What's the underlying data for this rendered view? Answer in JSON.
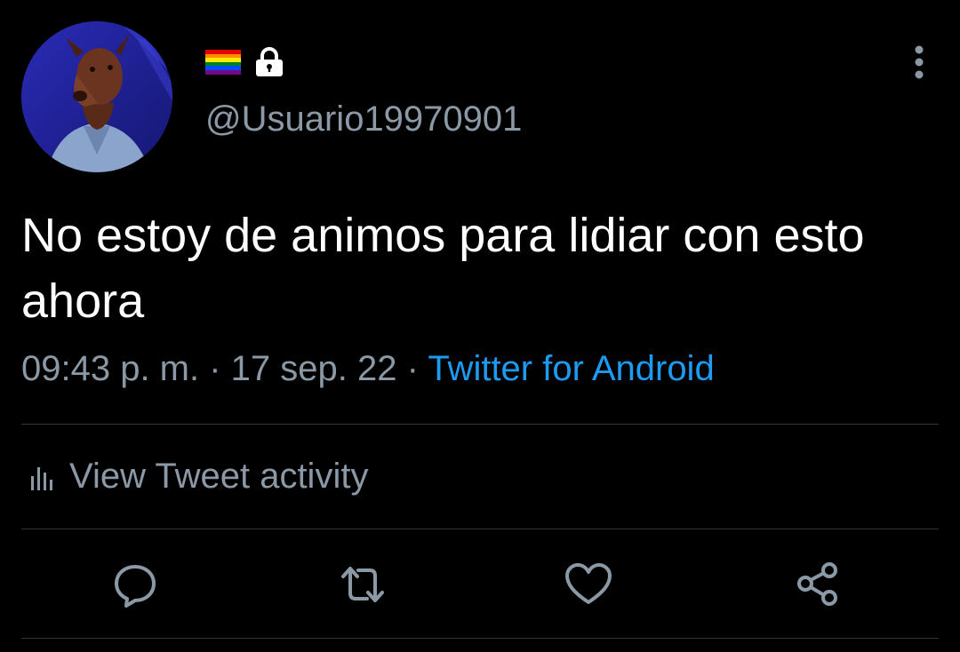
{
  "tweet": {
    "handle": "@Usuario19970901",
    "text": "No estoy de animos para lidiar con esto ahora",
    "time": "09:43 p. m.",
    "sep1": " · ",
    "date": "17 sep. 22",
    "sep2": " · ",
    "source": "Twitter for Android"
  },
  "activity": {
    "label": "View Tweet activity"
  },
  "icons": {
    "flag": "rainbow-flag-icon",
    "lock": "lock-icon",
    "more": "more-vertical-icon",
    "chart": "bar-chart-icon",
    "reply": "reply-icon",
    "retweet": "retweet-icon",
    "like": "like-icon",
    "share": "share-icon"
  },
  "colors": {
    "background": "#000000",
    "text": "#ffffff",
    "secondary": "#8b98a5",
    "link": "#1d9bf0",
    "divider": "#2f3336"
  }
}
